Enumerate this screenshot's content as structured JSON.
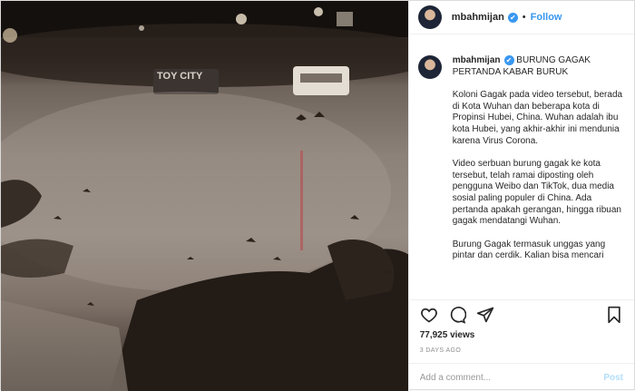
{
  "post": {
    "username": "mbahmijan",
    "verified_badge": "✔",
    "separator": "•",
    "follow_label": "Follow",
    "caption_title": "BURUNG GAGAK PERTANDA KABAR BURUK",
    "paragraphs": [
      "Koloni Gagak pada video tersebut, berada di Kota Wuhan dan beberapa kota di Propinsi Hubei, China. Wuhan adalah ibu kota Hubei, yang akhir-akhir ini mendunia karena Virus Corona.",
      "Video serbuan burung gagak ke kota tersebut, telah ramai diposting oleh pengguna Weibo dan TikTok, dua media sosial paling populer di China. Ada pertanda apakah gerangan, hingga ribuan gagak mendatangi Wuhan.",
      "Burung Gagak termasuk unggas yang pintar dan cerdik. Kalian bisa mencari"
    ],
    "likes": "77,925 views",
    "timestamp": "3 DAYS AGO",
    "comment_placeholder": "Add a comment...",
    "post_label": "Post"
  },
  "media": {
    "sign_text": "TOY CITY"
  },
  "icons": {
    "like": "heart-icon",
    "comment": "comment-icon",
    "share": "share-icon",
    "save": "bookmark-icon",
    "verified": "verified-badge-icon"
  },
  "colors": {
    "accent": "#3897f0",
    "post_disabled": "#b2dffc",
    "muted": "#8e8e8e"
  }
}
